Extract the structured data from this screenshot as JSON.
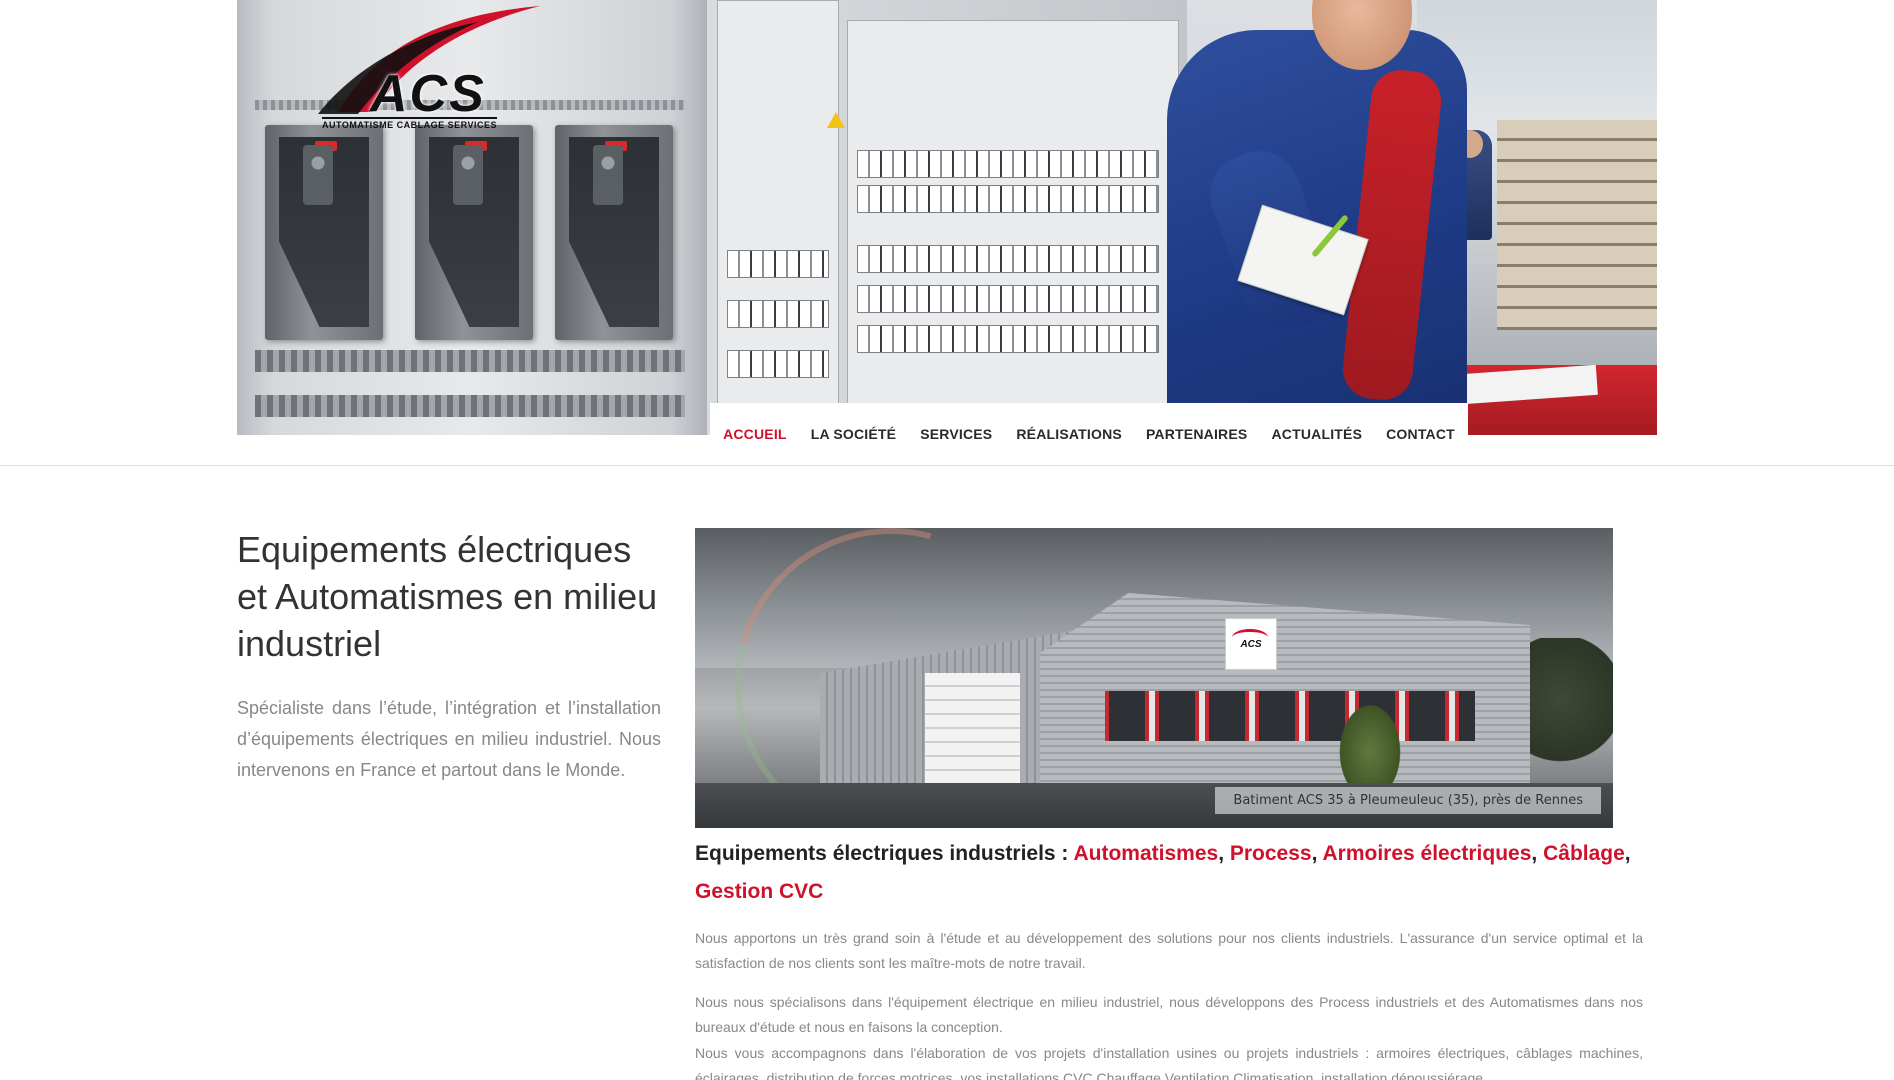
{
  "brand": {
    "logo_text": "ACS",
    "logo_subtitle": "AUTOMATISME CABLAGE SERVICES",
    "accent_color": "#d0112b"
  },
  "nav": {
    "items": [
      {
        "label": "ACCUEIL",
        "active": true
      },
      {
        "label": "LA SOCIÉTÉ",
        "active": false
      },
      {
        "label": "SERVICES",
        "active": false
      },
      {
        "label": "RÉALISATIONS",
        "active": false
      },
      {
        "label": "PARTENAIRES",
        "active": false
      },
      {
        "label": "ACTUALITÉS",
        "active": false
      },
      {
        "label": "CONTACT",
        "active": false
      }
    ]
  },
  "main": {
    "title": "Equipements électriques et Automatismes en milieu industriel",
    "intro": "Spécialiste dans l’étude, l’intégration et l’installation d’équipements électriques en milieu industriel. Nous intervenons en France et partout dans le Monde.",
    "photo_caption": "Batiment ACS 35 à Pleumeuleuc (35), près de Rennes",
    "sign_text": "ACS",
    "services_heading": {
      "prefix": "Equipements électriques industriels : ",
      "items": [
        "Automatismes",
        "Process",
        "Armoires électriques",
        "Câblage",
        "Gestion CVC"
      ],
      "separator": ", "
    },
    "paragraphs": [
      "Nous apportons un très grand soin à l'étude et au développement des solutions pour nos clients industriels. L'assurance d'un service optimal et la satisfaction de nos clients sont les maître-mots de notre travail.",
      "Nous nous spécialisons dans l'équipement électrique en milieu industriel, nous développons des Process industriels et des Automatismes dans nos bureaux d'étude et nous en faisons la conception.",
      "Nous vous accompagnons dans l'élaboration de vos projets d'installation usines ou projets industriels : armoires électriques, câblages machines, éclairages, distribution de forces motrices, vos installations CVC Chauffage Ventilation Climatisation, installation dépoussiérage..."
    ]
  }
}
